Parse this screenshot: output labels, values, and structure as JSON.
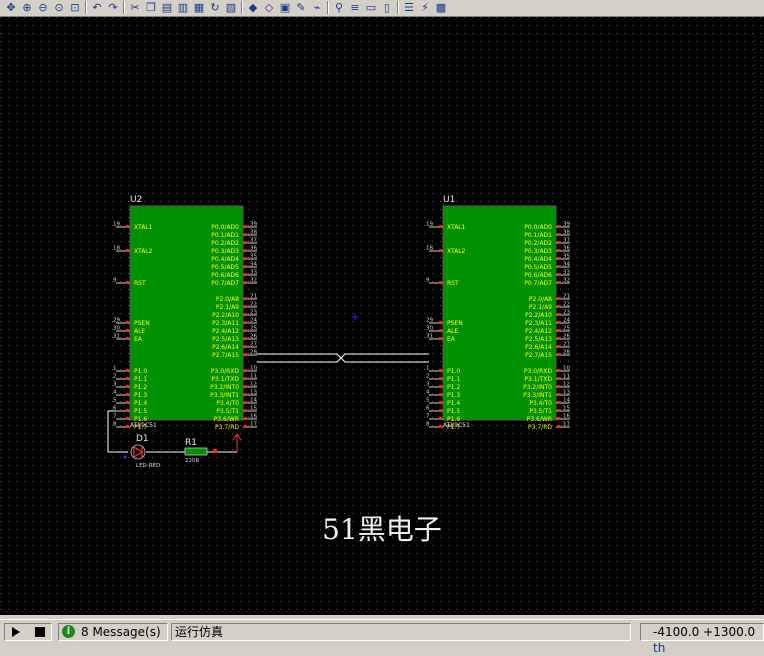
{
  "toolbar": {
    "buttons": [
      "pan-icon",
      "zoom-in-icon",
      "zoom-out-icon",
      "zoom-area-icon",
      "zoom-all-icon",
      "undo-icon",
      "redo-icon",
      "cut-icon",
      "copy-icon",
      "paste-icon",
      "block-copy-icon",
      "block-move-icon",
      "block-rotate-icon",
      "block-delete-icon",
      "pick-device-icon",
      "make-device-icon",
      "packaging-icon",
      "decompose-icon",
      "wire-autorouter-icon",
      "search-tag-icon",
      "property-assign-icon",
      "new-sheet-icon",
      "remove-sheet-icon",
      "bom-icon",
      "erc-icon",
      "netlist-icon"
    ]
  },
  "schematic": {
    "u2": {
      "ref": "U2",
      "part": "AT89C51",
      "left_pins": [
        {
          "num": "19",
          "name": "XTAL1"
        },
        {
          "num": "18",
          "name": "XTAL2"
        },
        {
          "num": "9",
          "name": "RST"
        },
        {
          "num": "29",
          "name": "PSEN"
        },
        {
          "num": "30",
          "name": "ALE"
        },
        {
          "num": "31",
          "name": "EA"
        },
        {
          "num": "1",
          "name": "P1.0"
        },
        {
          "num": "2",
          "name": "P1.1"
        },
        {
          "num": "3",
          "name": "P1.2"
        },
        {
          "num": "4",
          "name": "P1.3"
        },
        {
          "num": "5",
          "name": "P1.4"
        },
        {
          "num": "6",
          "name": "P1.5"
        },
        {
          "num": "7",
          "name": "P1.6"
        },
        {
          "num": "8",
          "name": "P1.7"
        }
      ],
      "right_pins": [
        {
          "num": "39",
          "name": "P0.0/AD0"
        },
        {
          "num": "38",
          "name": "P0.1/AD1"
        },
        {
          "num": "37",
          "name": "P0.2/AD2"
        },
        {
          "num": "36",
          "name": "P0.3/AD3"
        },
        {
          "num": "35",
          "name": "P0.4/AD4"
        },
        {
          "num": "34",
          "name": "P0.5/AD5"
        },
        {
          "num": "33",
          "name": "P0.6/AD6"
        },
        {
          "num": "32",
          "name": "P0.7/AD7"
        },
        {
          "num": "21",
          "name": "P2.0/A8"
        },
        {
          "num": "22",
          "name": "P2.1/A9"
        },
        {
          "num": "23",
          "name": "P2.2/A10"
        },
        {
          "num": "24",
          "name": "P2.3/A11"
        },
        {
          "num": "25",
          "name": "P2.4/A12"
        },
        {
          "num": "26",
          "name": "P2.5/A13"
        },
        {
          "num": "27",
          "name": "P2.6/A14"
        },
        {
          "num": "28",
          "name": "P2.7/A15"
        },
        {
          "num": "10",
          "name": "P3.0/RXD"
        },
        {
          "num": "11",
          "name": "P3.1/TXD"
        },
        {
          "num": "12",
          "name": "P3.2/INT0"
        },
        {
          "num": "13",
          "name": "P3.3/INT1"
        },
        {
          "num": "14",
          "name": "P3.4/T0"
        },
        {
          "num": "15",
          "name": "P3.5/T1"
        },
        {
          "num": "16",
          "name": "P3.6/WR"
        },
        {
          "num": "17",
          "name": "P3.7/RD"
        }
      ]
    },
    "u1": {
      "ref": "U1",
      "part": "AT89C51"
    },
    "d1": {
      "ref": "D1",
      "value": "LED-RED"
    },
    "r1": {
      "ref": "R1",
      "value": "220R"
    },
    "caption": "51黑电子"
  },
  "statusbar": {
    "messages": "8 Message(s)",
    "status_text": "运行仿真",
    "coords": "-4100.0  +1300.0",
    "coords_suffix": "th"
  },
  "colors": {
    "background": "#000000",
    "grid_dot": "#5a5a5a",
    "chip_fill": "#009100",
    "pin_label": "#ffff00",
    "pin_line": "#d0d0d0",
    "wire": "#ffffff",
    "pin_marker": "#ff2020"
  }
}
